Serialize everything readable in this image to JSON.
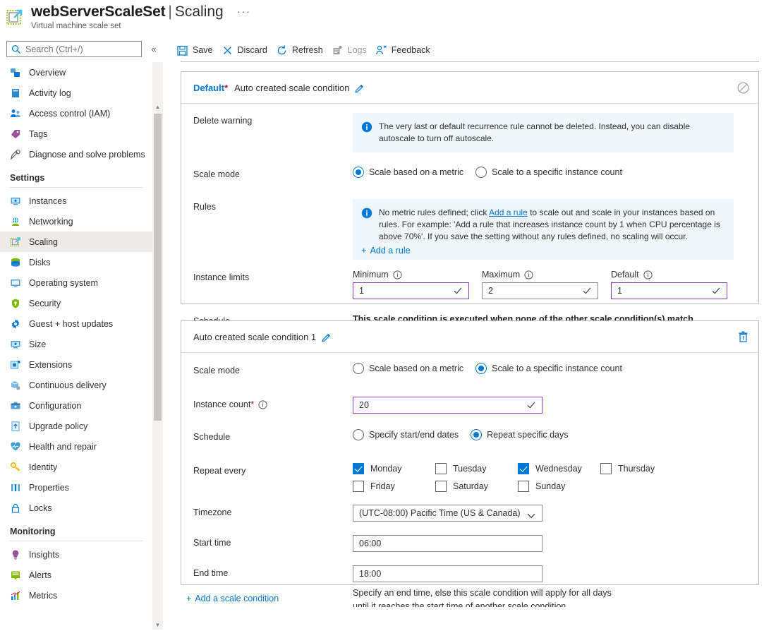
{
  "header": {
    "resource_name": "webServerScaleSet",
    "separator": "|",
    "page": "Scaling",
    "ellipsis": "···",
    "subtitle": "Virtual machine scale set",
    "resource_icon": "vm-scale-set-icon"
  },
  "search": {
    "placeholder": "Search (Ctrl+/)",
    "value": ""
  },
  "sidebar": {
    "collapse_label": "«",
    "items": [
      {
        "label": "Overview",
        "icon": "overview-icon",
        "selected": false
      },
      {
        "label": "Activity log",
        "icon": "activity-log-icon",
        "selected": false
      },
      {
        "label": "Access control (IAM)",
        "icon": "access-control-icon",
        "selected": false
      },
      {
        "label": "Tags",
        "icon": "tags-icon",
        "selected": false
      },
      {
        "label": "Diagnose and solve problems",
        "icon": "diagnose-icon",
        "selected": false
      }
    ],
    "groups": [
      {
        "title": "Settings",
        "items": [
          {
            "label": "Instances",
            "icon": "instances-icon",
            "selected": false
          },
          {
            "label": "Networking",
            "icon": "networking-icon",
            "selected": false
          },
          {
            "label": "Scaling",
            "icon": "scaling-icon",
            "selected": true
          },
          {
            "label": "Disks",
            "icon": "disks-icon",
            "selected": false
          },
          {
            "label": "Operating system",
            "icon": "operating-system-icon",
            "selected": false
          },
          {
            "label": "Security",
            "icon": "security-icon",
            "selected": false
          },
          {
            "label": "Guest + host updates",
            "icon": "guest-host-updates-icon",
            "selected": false
          },
          {
            "label": "Size",
            "icon": "size-icon",
            "selected": false
          },
          {
            "label": "Extensions",
            "icon": "extensions-icon",
            "selected": false
          },
          {
            "label": "Continuous delivery",
            "icon": "continuous-delivery-icon",
            "selected": false
          },
          {
            "label": "Configuration",
            "icon": "configuration-icon",
            "selected": false
          },
          {
            "label": "Upgrade policy",
            "icon": "upgrade-policy-icon",
            "selected": false
          },
          {
            "label": "Health and repair",
            "icon": "health-repair-icon",
            "selected": false
          },
          {
            "label": "Identity",
            "icon": "identity-icon",
            "selected": false
          },
          {
            "label": "Properties",
            "icon": "properties-icon",
            "selected": false
          },
          {
            "label": "Locks",
            "icon": "locks-icon",
            "selected": false
          }
        ]
      },
      {
        "title": "Monitoring",
        "items": [
          {
            "label": "Insights",
            "icon": "insights-icon",
            "selected": false
          },
          {
            "label": "Alerts",
            "icon": "alerts-icon",
            "selected": false
          },
          {
            "label": "Metrics",
            "icon": "metrics-icon",
            "selected": false
          }
        ]
      }
    ]
  },
  "toolbar": {
    "save_label": "Save",
    "discard_label": "Discard",
    "refresh_label": "Refresh",
    "logs_label": "Logs",
    "logs_disabled": true,
    "feedback_label": "Feedback"
  },
  "default_condition": {
    "badge": "Default",
    "required_marker": "*",
    "name": "Auto created scale condition",
    "edit_icon": "pencil-icon",
    "disable_icon": "disabled-circle-icon",
    "delete_warning_label": "Delete warning",
    "delete_warning_text": "The very last or default recurrence rule cannot be deleted. Instead, you can disable autoscale to turn off autoscale.",
    "scale_mode_label": "Scale mode",
    "scale_mode_options": [
      {
        "label": "Scale based on a metric",
        "selected": true
      },
      {
        "label": "Scale to a specific instance count",
        "selected": false
      }
    ],
    "rules_label": "Rules",
    "rules_text_1": "No metric rules defined; click ",
    "rules_link": "Add a rule",
    "rules_text_2": " to scale out and scale in your instances based on rules. For example: 'Add a rule that increases instance count by 1 when CPU percentage is above 70%'. If you save the setting without any rules defined, no scaling will occur.",
    "add_rule_label": "Add a rule",
    "instance_limits_label": "Instance limits",
    "limits": [
      {
        "label": "Minimum",
        "value": "1",
        "modified": true
      },
      {
        "label": "Maximum",
        "value": "2",
        "modified": false
      },
      {
        "label": "Default",
        "value": "1",
        "modified": true
      }
    ],
    "schedule_label": "Schedule",
    "schedule_text": "This scale condition is executed when none of the other scale condition(s) match"
  },
  "second_condition": {
    "name": "Auto created scale condition 1",
    "edit_icon": "pencil-icon",
    "delete_icon": "trash-icon",
    "scale_mode_label": "Scale mode",
    "scale_mode_options": [
      {
        "label": "Scale based on a metric",
        "selected": false
      },
      {
        "label": "Scale to a specific instance count",
        "selected": true
      }
    ],
    "instance_count_label": "Instance count",
    "instance_count_required": "*",
    "instance_count_value": "20",
    "schedule_label": "Schedule",
    "schedule_options": [
      {
        "label": "Specify start/end dates",
        "selected": false
      },
      {
        "label": "Repeat specific days",
        "selected": true
      }
    ],
    "repeat_label": "Repeat every",
    "days": [
      {
        "label": "Monday",
        "checked": true
      },
      {
        "label": "Tuesday",
        "checked": false
      },
      {
        "label": "Wednesday",
        "checked": true
      },
      {
        "label": "Thursday",
        "checked": false
      },
      {
        "label": "Friday",
        "checked": false
      },
      {
        "label": "Saturday",
        "checked": false
      },
      {
        "label": "Sunday",
        "checked": false
      }
    ],
    "timezone_label": "Timezone",
    "timezone_value": "(UTC-08:00) Pacific Time (US & Canada)",
    "start_time_label": "Start time",
    "start_time_value": "06:00",
    "end_time_label": "End time",
    "end_time_value": "18:00",
    "end_time_helper": "Specify an end time, else this scale condition will apply for all days until it reaches the start time of another scale condition"
  },
  "footer": {
    "add_condition_label": "Add a scale condition"
  },
  "colors": {
    "accent": "#0078d4",
    "modified_border": "#8e3faf",
    "required": "#a4262c",
    "info_bg": "#eff6fc",
    "selected_nav_bg": "#edebe9"
  }
}
